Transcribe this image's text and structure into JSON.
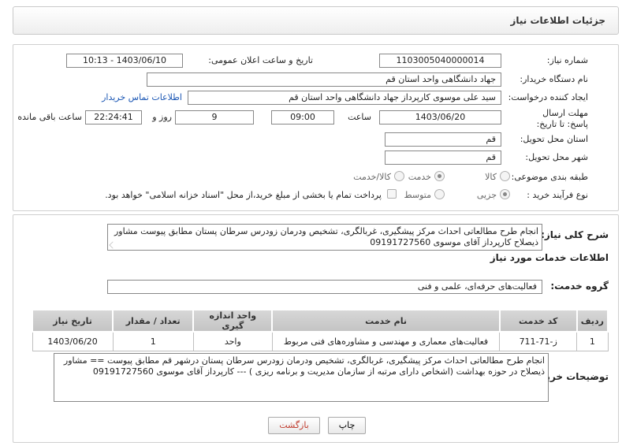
{
  "header": {
    "title": "جزئیات اطلاعات نیاز"
  },
  "form": {
    "need_number_label": "شماره نیاز:",
    "need_number": "1103005040000014",
    "announce_label": "تاریخ و ساعت اعلان عمومی:",
    "announce_value": "1403/06/10 - 10:13",
    "buyer_org_label": "نام دستگاه خریدار:",
    "buyer_org": "جهاد دانشگاهی واحد استان قم",
    "creator_label": "ایجاد کننده درخواست:",
    "creator": "سید علی موسوی کارپرداز جهاد دانشگاهی واحد استان قم",
    "contact_link": "اطلاعات تماس خریدار",
    "deadline_label": "مهلت ارسال پاسخ: تا تاریخ:",
    "deadline_date": "1403/06/20",
    "time_label": "ساعت",
    "deadline_time": "09:00",
    "days_value": "9",
    "day_and_label": "روز و",
    "remaining_time": "22:24:41",
    "remaining_label": "ساعت باقی مانده",
    "province_label": "استان محل تحویل:",
    "province": "قم",
    "city_label": "شهر محل تحویل:",
    "city": "قم",
    "category_label": "طبقه بندی موضوعی:",
    "category_options": [
      "کالا",
      "خدمت",
      "کالا/خدمت"
    ],
    "category_selected": "خدمت",
    "process_label": "نوع فرآیند خرید :",
    "process_options": [
      "جزیی",
      "متوسط"
    ],
    "process_selected": "جزیی",
    "payment_note": "پرداخت تمام یا بخشی از مبلغ خرید،از محل \"اسناد خزانه اسلامی\" خواهد بود."
  },
  "details": {
    "summary_label": "شرح کلی نیاز:",
    "summary": "انجام طرح مطالعاتی احداث مرکز پیشگیری، غربالگری، تشخیص ودرمان زودرس سرطان پستان مطابق پیوست مشاور ذیصلاح  کارپرداز آقای موسوی 09191727560",
    "services_title": "اطلاعات خدمات مورد نیاز",
    "service_group_label": "گروه خدمت:",
    "service_group": "فعالیت‌های حرفه‌ای، علمی و فنی",
    "table": {
      "headers": [
        "ردیف",
        "کد خدمت",
        "نام خدمت",
        "واحد اندازه گیری",
        "تعداد / مقدار",
        "تاریخ نیاز"
      ],
      "rows": [
        [
          "1",
          "ز-71-711",
          "فعالیت‌های معماری و مهندسی و مشاوره‌های فنی مربوط",
          "واحد",
          "1",
          "1403/06/20"
        ]
      ]
    },
    "buyer_notes_label": "توضیحات خریدار:",
    "buyer_notes": "انجام طرح مطالعاتی احداث مرکز پیشگیری، غربالگری، تشخیص ودرمان زودرس سرطان پستان درشهر قم مطابق پیوست == مشاور ذیصلاح در حوزه بهداشت (اشخاص دارای مرتبه از سازمان مدیریت و برنامه ریزی ) --- کارپرداز آقای موسوی 09191727560"
  },
  "buttons": {
    "print": "چاپ",
    "back": "بازگشت"
  },
  "watermark_text": "AriaTender.neT",
  "colors": {
    "link": "#1a56b4",
    "back_button_text": "#c0392b",
    "watermark": "#d44"
  }
}
